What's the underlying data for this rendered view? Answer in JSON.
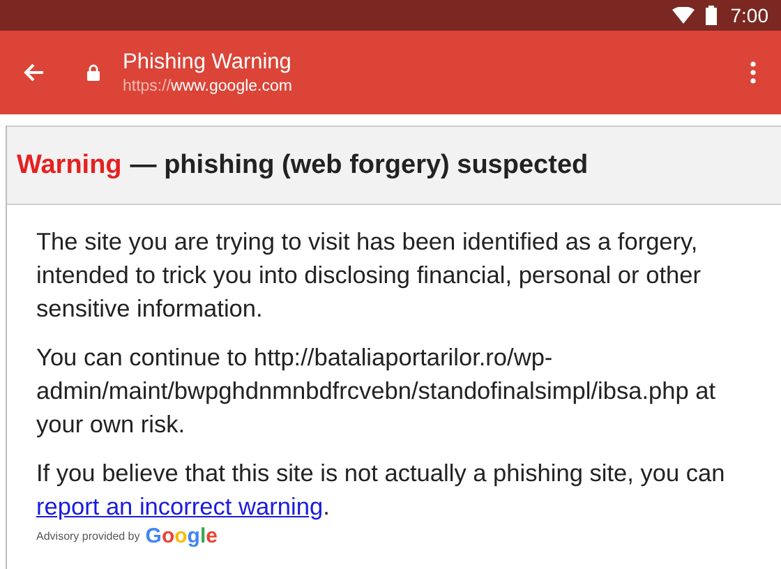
{
  "status_bar": {
    "time": "7:00"
  },
  "toolbar": {
    "title": "Phishing Warning",
    "url_scheme": "https://",
    "url_host": "www.google.com"
  },
  "heading": {
    "label": "Warning",
    "text": "— phishing (web forgery) suspected"
  },
  "paragraphs": [
    {
      "text": "The site you are trying to visit has been identified as a forgery, intended to trick you into disclosing financial, personal or other sensitive information."
    },
    {
      "text": "You can continue to http://bataliaportarilor.ro/wp-admin/maint/bwpghdnmnbdfrcvebn/standofinalsimpl/ibsa.php at your own risk."
    },
    {
      "text": "If you believe that this site is not actually a phishing site, you can",
      "link": "report an incorrect warning",
      "after": "."
    }
  ],
  "advisory": {
    "text": "Advisory provided by",
    "logo": "Google"
  }
}
